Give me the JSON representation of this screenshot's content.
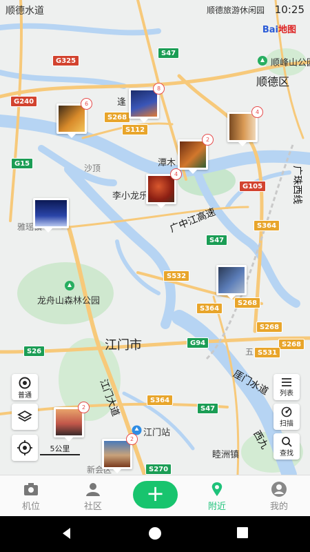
{
  "status_bar": {
    "left_label": "顺德水道",
    "right_label": "顺德旅游休闲园",
    "time": "10:25"
  },
  "map": {
    "brand": {
      "text": "Bai",
      "suffix": "地图"
    },
    "places": {
      "shunfeng": "顺峰山公园",
      "shunde": "顺德区",
      "feng": "逢",
      "tanzhou": "潭木",
      "shading": "沙顶",
      "lixiaolong": "李小龙乐",
      "yali": "雅瑶镇",
      "longzhou": "龙舟山森林公园",
      "jiangmen": "江门市",
      "wuxian": "五顷",
      "jiangmen_station": "江门站",
      "suixi": "睦洲镇",
      "xinhui": "新会区",
      "jiangmen_ave": "江门大道",
      "guangzhong": "广中江高速",
      "yamen": "厓门水道",
      "xihu": "西九",
      "guangzhu": "广珠西线"
    },
    "road_shields": {
      "g325": "G325",
      "g240": "G240",
      "g15": "G15",
      "s47a": "S47",
      "s268a": "S268",
      "s112": "S112",
      "g105": "G105",
      "s364a": "S364",
      "s47b": "S47",
      "s532": "S532",
      "s364b": "S364",
      "s268b": "S268",
      "g94": "G94",
      "s268c": "S268",
      "s268d": "S268",
      "s531": "S531",
      "s26": "S26",
      "s364c": "S364",
      "s47c": "S47",
      "s270": "S270"
    },
    "pins": [
      {
        "count": "6",
        "colors": [
          "#3d2b18",
          "#d88a2a",
          "#f3c45a"
        ]
      },
      {
        "count": "8",
        "colors": [
          "#1b2c6b",
          "#3a56b8",
          "#e07a35"
        ]
      },
      {
        "count": "4",
        "colors": [
          "#7a4b22",
          "#d99a55",
          "#f0d8b8"
        ]
      },
      {
        "count": "2",
        "colors": [
          "#6b2d12",
          "#d2772c",
          "#2f5d33"
        ]
      },
      {
        "count": "4",
        "colors": [
          "#8c1f13",
          "#d9582e",
          "#4a2b1e"
        ]
      },
      {
        "count": "",
        "colors": [
          "#0c1a55",
          "#2a44a8",
          "#b6c6ee"
        ]
      },
      {
        "count": "",
        "colors": [
          "#2b3a55",
          "#5b7db8",
          "#aab9cd"
        ]
      },
      {
        "count": "2",
        "colors": [
          "#3a2a2a",
          "#c2574a",
          "#e8a36b"
        ]
      },
      {
        "count": "2",
        "colors": [
          "#4a7ab8",
          "#c8a27a",
          "#7a3b1e"
        ]
      }
    ],
    "scale": "5公里"
  },
  "controls": {
    "normal": "普通",
    "list": "列表",
    "scan": "扫描",
    "find": "查找"
  },
  "tabs": {
    "jiwei": "机位",
    "shequ": "社区",
    "add": "+",
    "fujin": "附近",
    "wode": "我的"
  },
  "colors": {
    "accent": "#1ec27a",
    "add_button": "#18c46e",
    "water": "#b6d4f3",
    "green_area": "#bfe3c4",
    "road": "#f7c97a"
  }
}
